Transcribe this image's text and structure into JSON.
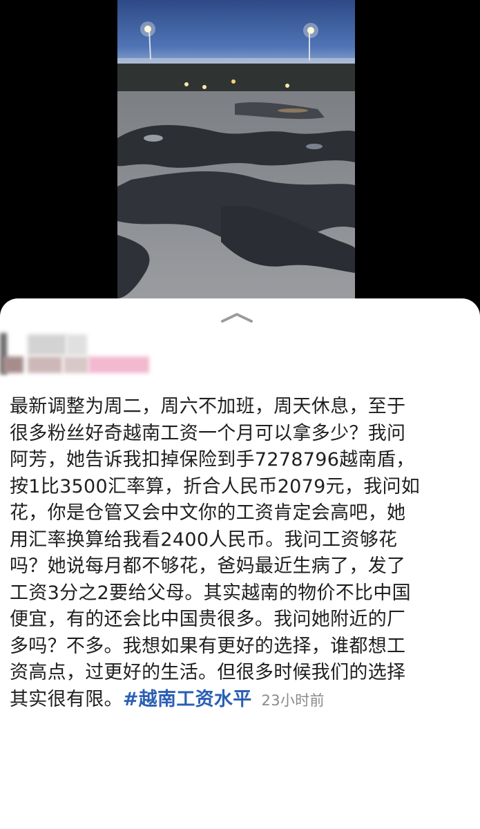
{
  "media": {
    "kind": "photo",
    "icon": "photo-thumbnail"
  },
  "sheet": {
    "handle_icon": "chevron-up-icon",
    "author": {
      "avatar": "blurred",
      "name": "blurred"
    },
    "post": {
      "lines": [
        "最新调整为周二，周六不加班，周天休息，至于",
        "很多粉丝好奇越南工资一个月可以拿多少？我问",
        "阿芳，她告诉我扣掉保险到手7278796越南盾，",
        "按1比3500汇率算，折合人民币2079元，我问如",
        "花，你是仓管又会中文你的工资肯定会高吧，她",
        "用汇率换算给我看2400人民币。我问工资够花",
        "吗？她说每月都不够花，爸妈最近生病了，发了",
        "工资3分之2要给父母。其实越南的物价不比中国",
        "便宜，有的还会比中国贵很多。我问她附近的厂",
        "多吗？不多。我想如果有更好的选择，谁都想工",
        "资高点，过更好的生活。但很多时候我们的选择"
      ],
      "last_line": "其实很有限。",
      "hashtag": "#越南工资水平",
      "timestamp": "23小时前"
    }
  },
  "colors": {
    "hashtag": "#2a5fb4",
    "text": "#1f1f1f",
    "timestamp": "#8a8a8a"
  }
}
